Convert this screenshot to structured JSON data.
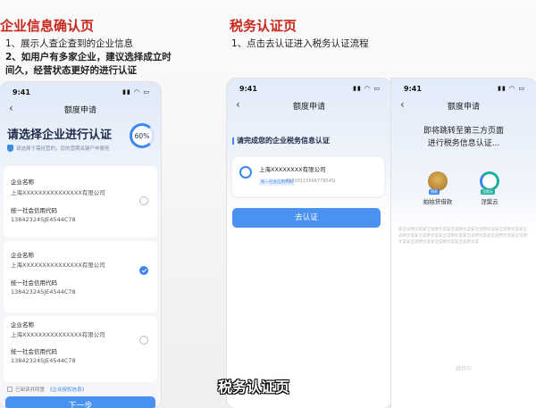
{
  "left_section": {
    "title": "企业信息确认页",
    "notes": [
      "1、展示人查企查到的企业信息",
      "2、如用户有多家企业，建议选择成立时",
      "间久，经营状态更好的进行认证"
    ]
  },
  "right_section": {
    "title": "税务认证页",
    "notes": [
      "1、点击去认证进入税务认证流程"
    ]
  },
  "status_bar": {
    "time": "9:41",
    "icons": "▮▮ ◠ ▭"
  },
  "nav": {
    "back_icon": "‹",
    "close_icon": "‹",
    "title": "额度申请"
  },
  "phone1": {
    "heading": "请选择企业进行认证",
    "subtext": "请选择于需经营的，您的营期关键产申服务",
    "progress": "60%",
    "companies": [
      {
        "name_label": "企业名称",
        "name": "上海XXXXXXXXXXXXXXX有限公司",
        "code_label": "统一社会信用代码",
        "code": "13842324SJE4544C78",
        "selected": false
      },
      {
        "name_label": "企业名称",
        "name": "上海XXXXXXXXXXXXXXX有限公司",
        "code_label": "统一社会信用代码",
        "code": "13842324SJE4544C78",
        "selected": true
      },
      {
        "name_label": "企业名称",
        "name": "上海XXXXXXXXXXXXXXX有限公司",
        "code_label": "统一社会信用代码",
        "code": "13842324SJE4544C78",
        "selected": false
      }
    ],
    "agree_text": "已阅读并同意",
    "agree_link": "《企业授权信息》",
    "next_button": "下一步"
  },
  "phone2": {
    "heading": "请完成您的企业税务信息认证",
    "company_name": "上海XXXXXXXX有限公司",
    "tag": "统一社会信用代码",
    "code": "91310115666778545J",
    "button": "去认证"
  },
  "phone3": {
    "jump_line1": "即将跳转至第三方页面",
    "jump_line2": "进行税务信息认证...",
    "partners": [
      {
        "name": "拍拍贷借款",
        "tag": "借款",
        "color": "#c9953a"
      },
      {
        "name": "涅槃云",
        "tag": "涅槃云",
        "color": "#1fae9b"
      }
    ],
    "disclaimer": "安全说明文案安全说明文案安全说明文案安全说明文案安全说明文案安全说明文案安全说明文案安全说明文案安全说明文案安全说明文案安全说明文案安全说明文案安全说明文案安全说明文案",
    "faint_button": "跳转中"
  },
  "caption": "税务认证页",
  "colors": {
    "accent": "#3c86f0",
    "section_title": "#c8281e"
  }
}
